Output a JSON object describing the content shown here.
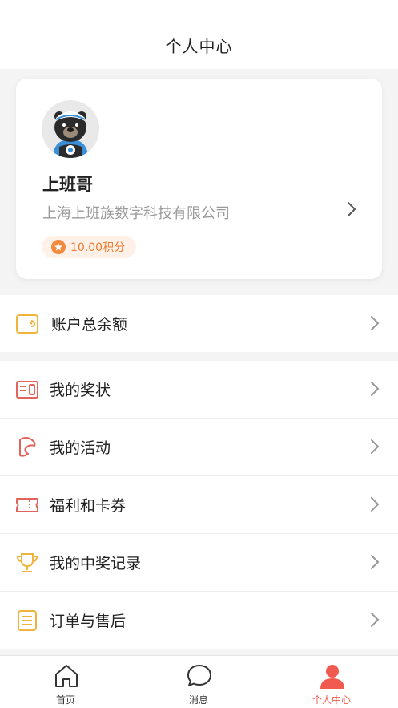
{
  "header": {
    "title": "个人中心"
  },
  "profile": {
    "name": "上班哥",
    "company": "上海上班族数字科技有限公司",
    "points": "10.00积分"
  },
  "account": {
    "balance_label": "账户总余额"
  },
  "menu": [
    {
      "label": "我的奖状",
      "icon": "certificate-icon"
    },
    {
      "label": "我的活动",
      "icon": "flag-icon"
    },
    {
      "label": "福利和卡券",
      "icon": "ticket-icon"
    },
    {
      "label": "我的中奖记录",
      "icon": "trophy-icon"
    },
    {
      "label": "订单与售后",
      "icon": "order-list-icon"
    }
  ],
  "tabs": [
    {
      "label": "首页",
      "icon": "home-icon",
      "active": false
    },
    {
      "label": "消息",
      "icon": "chat-bubble-icon",
      "active": false
    },
    {
      "label": "个人中心",
      "icon": "user-icon",
      "active": true
    }
  ],
  "colors": {
    "accent": "#f05a4f",
    "points_orange": "#ee7a2d",
    "icon_yellow": "#f0b43c",
    "icon_red": "#e0645c"
  }
}
